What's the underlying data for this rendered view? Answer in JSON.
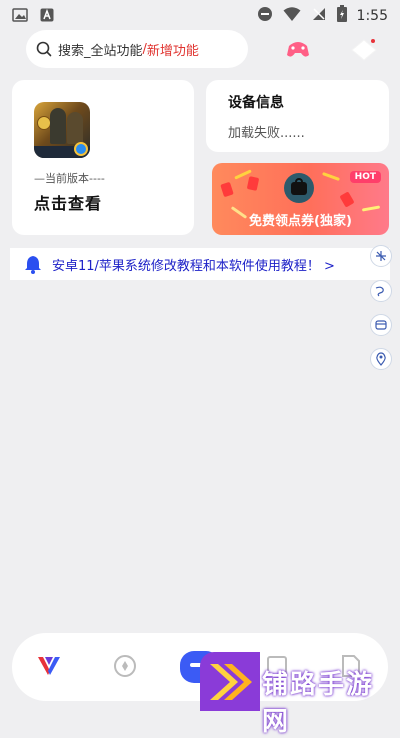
{
  "status_bar": {
    "time": "1:55",
    "left_icons": [
      "image-icon",
      "font-icon"
    ],
    "right_icons": [
      "dnd-icon",
      "wifi-icon",
      "no-sim-icon",
      "battery-icon"
    ]
  },
  "header": {
    "search": {
      "prefix": "搜索_全站功能",
      "separator": "/",
      "highlight": "新增功能"
    },
    "icons": [
      "game-controller-icon",
      "diamond-icon"
    ]
  },
  "game_card": {
    "version_label": "—当前版本----",
    "view_label": "点击查看"
  },
  "device_card": {
    "title": "设备信息",
    "status": "加载失败......"
  },
  "coupon_banner": {
    "badge": "HOT",
    "label": "免费领点券(独家)"
  },
  "notice": {
    "text": "安卓11/苹果系统修改教程和本软件使用教程！ >"
  },
  "side_tools": [
    "crosshair-icon",
    "wind-icon",
    "window-icon",
    "location-icon"
  ],
  "bottom_nav": [
    "app-logo-icon",
    "compass-icon",
    "home-icon",
    "square-icon",
    "document-icon"
  ],
  "watermark": {
    "text": "铺路手游网"
  },
  "colors": {
    "accent_red": "#e0332f",
    "notice_blue": "#1e22c8",
    "nav_active": "#3b5bf5",
    "coupon_orange": "#ff7a5a"
  }
}
